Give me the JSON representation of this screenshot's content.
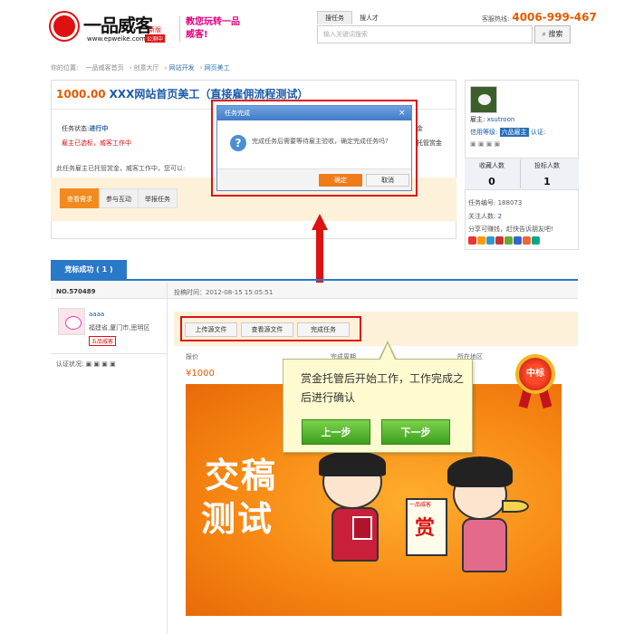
{
  "header": {
    "logo_brand": "一品威客",
    "logo_url": "www.epweike.com",
    "logo_tag_new": "新版",
    "logo_tag_beta": "公测中",
    "slogan": "教您玩转一品威客!",
    "tabs": [
      "搜任务",
      "搜人才"
    ],
    "hotline_label": "客服热线:",
    "hotline_number": "4006-999-467",
    "search_placeholder": "输入关键词搜索",
    "search_button": "搜索"
  },
  "breadcrumb": {
    "prefix": "你的位置:",
    "items": [
      "一品威客首页",
      "创意大厅",
      "网站开发",
      "网页美工"
    ]
  },
  "task": {
    "price": "1000.00",
    "title": "XXX网站首页美工（直接雇佣流程测试）",
    "status_label": "任务状态:",
    "status_value": "进行中",
    "status_note": "雇主已选标，威客工作中",
    "pay_row1": "金",
    "pay_row2": "托管赏金",
    "info": "此任务雇主已托管赏金，威客工作中，您可以:",
    "step_tabs": [
      "查看需求",
      "参与互动",
      "举报任务"
    ]
  },
  "sidebar": {
    "owner_label": "雇主:",
    "owner_name": "xsutroon",
    "credit_label": "信用等级:",
    "credit_badge": "六品雇主",
    "auth_label": "认证:",
    "stats": [
      {
        "label": "收藏人数",
        "value": "0"
      },
      {
        "label": "投标人数",
        "value": "1"
      }
    ],
    "task_no": "任务编号: 188073",
    "follow_label": "关注人数:",
    "follow_value": "2",
    "share": "分享可赚钱，赶快告诉朋友吧!"
  },
  "modal": {
    "title": "任务完成",
    "close": "×",
    "message": "完成任务后需要等待雇主验收，确定完成任务吗?",
    "ok": "确定",
    "cancel": "取消"
  },
  "bid": {
    "tab": "竞标成功 ( 1 )",
    "number": "NO.570489",
    "time": "投稿时间：2012-08-15 15:05:51",
    "user": "aaaa",
    "location": "福建省,厦门市,思明区",
    "level_badge": "五品威客",
    "auth": "认证状况:",
    "buttons": [
      "上传源文件",
      "查看源文件",
      "完成任务"
    ],
    "columns": [
      "报价",
      "完成周期",
      "所在地区"
    ],
    "price": "¥1000",
    "art_text_line1": "交稿",
    "art_text_line2": "测试",
    "scroll_char": "赏",
    "scroll_logo": "一品威客",
    "medal": "中标"
  },
  "tooltip": {
    "text": "赏金托管后开始工作，工作完成之后进行确认",
    "prev": "上一步",
    "next": "下一步"
  }
}
